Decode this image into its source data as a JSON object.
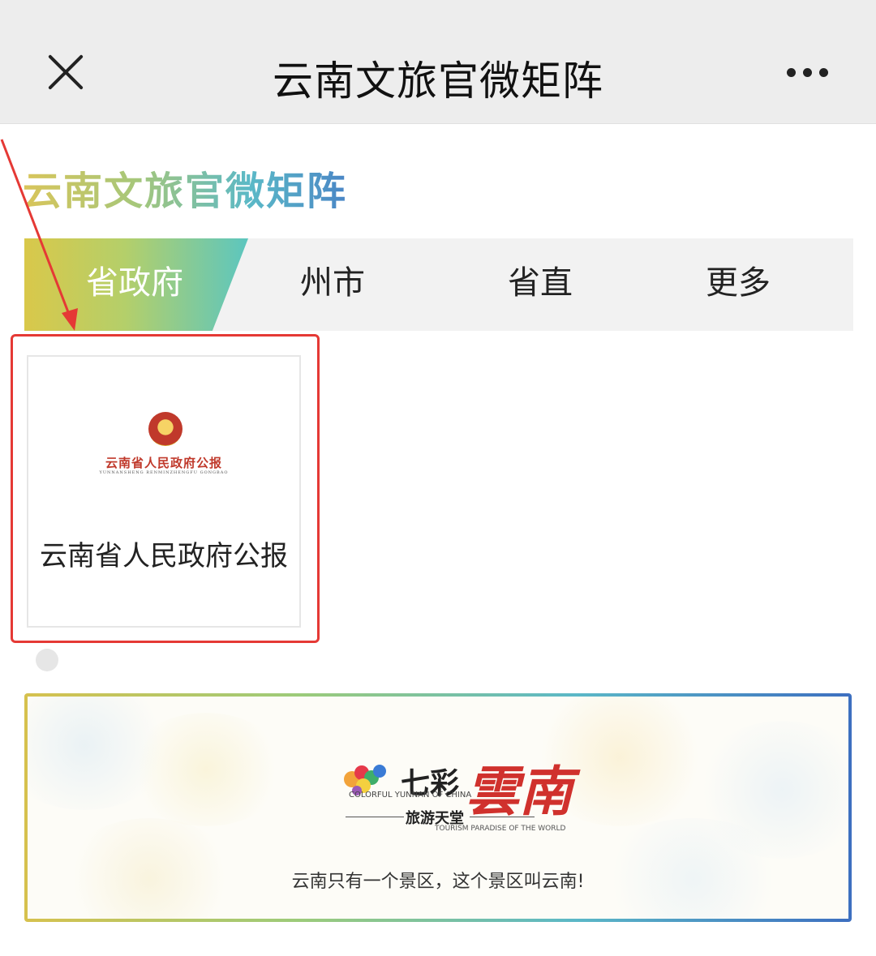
{
  "nav": {
    "title": "云南文旅官微矩阵",
    "close_icon": "close-icon",
    "more_icon": "more-horizontal-icon"
  },
  "brand": {
    "title": "云南文旅官微矩阵",
    "gradient_colors": [
      "#d9c55a",
      "#a6c77a",
      "#5bb9c7",
      "#4a86c6"
    ]
  },
  "tabs": [
    {
      "label": "省政府",
      "active": true
    },
    {
      "label": "州市",
      "active": false
    },
    {
      "label": "省直",
      "active": false
    },
    {
      "label": "更多",
      "active": false
    }
  ],
  "accounts": [
    {
      "name": "云南省人民政府公报",
      "logo_text_cn": "云南省人民政府公报",
      "logo_text_en": "YUNNANSHENG RENMINZHENGFU GONGBAO",
      "logo_icon": "national-emblem-icon"
    }
  ],
  "highlight_color": "#e53935",
  "banner": {
    "logo_text_qicai": "七彩",
    "logo_text_yunnan": "雲南",
    "logo_en_colorful": "COLORFUL YUNNAN OF CHINA",
    "logo_text_tourism": "旅游天堂",
    "logo_en_tourism": "TOURISM PARADISE OF THE WORLD",
    "slogan": "云南只有一个景区，这个景区叫云南!"
  }
}
